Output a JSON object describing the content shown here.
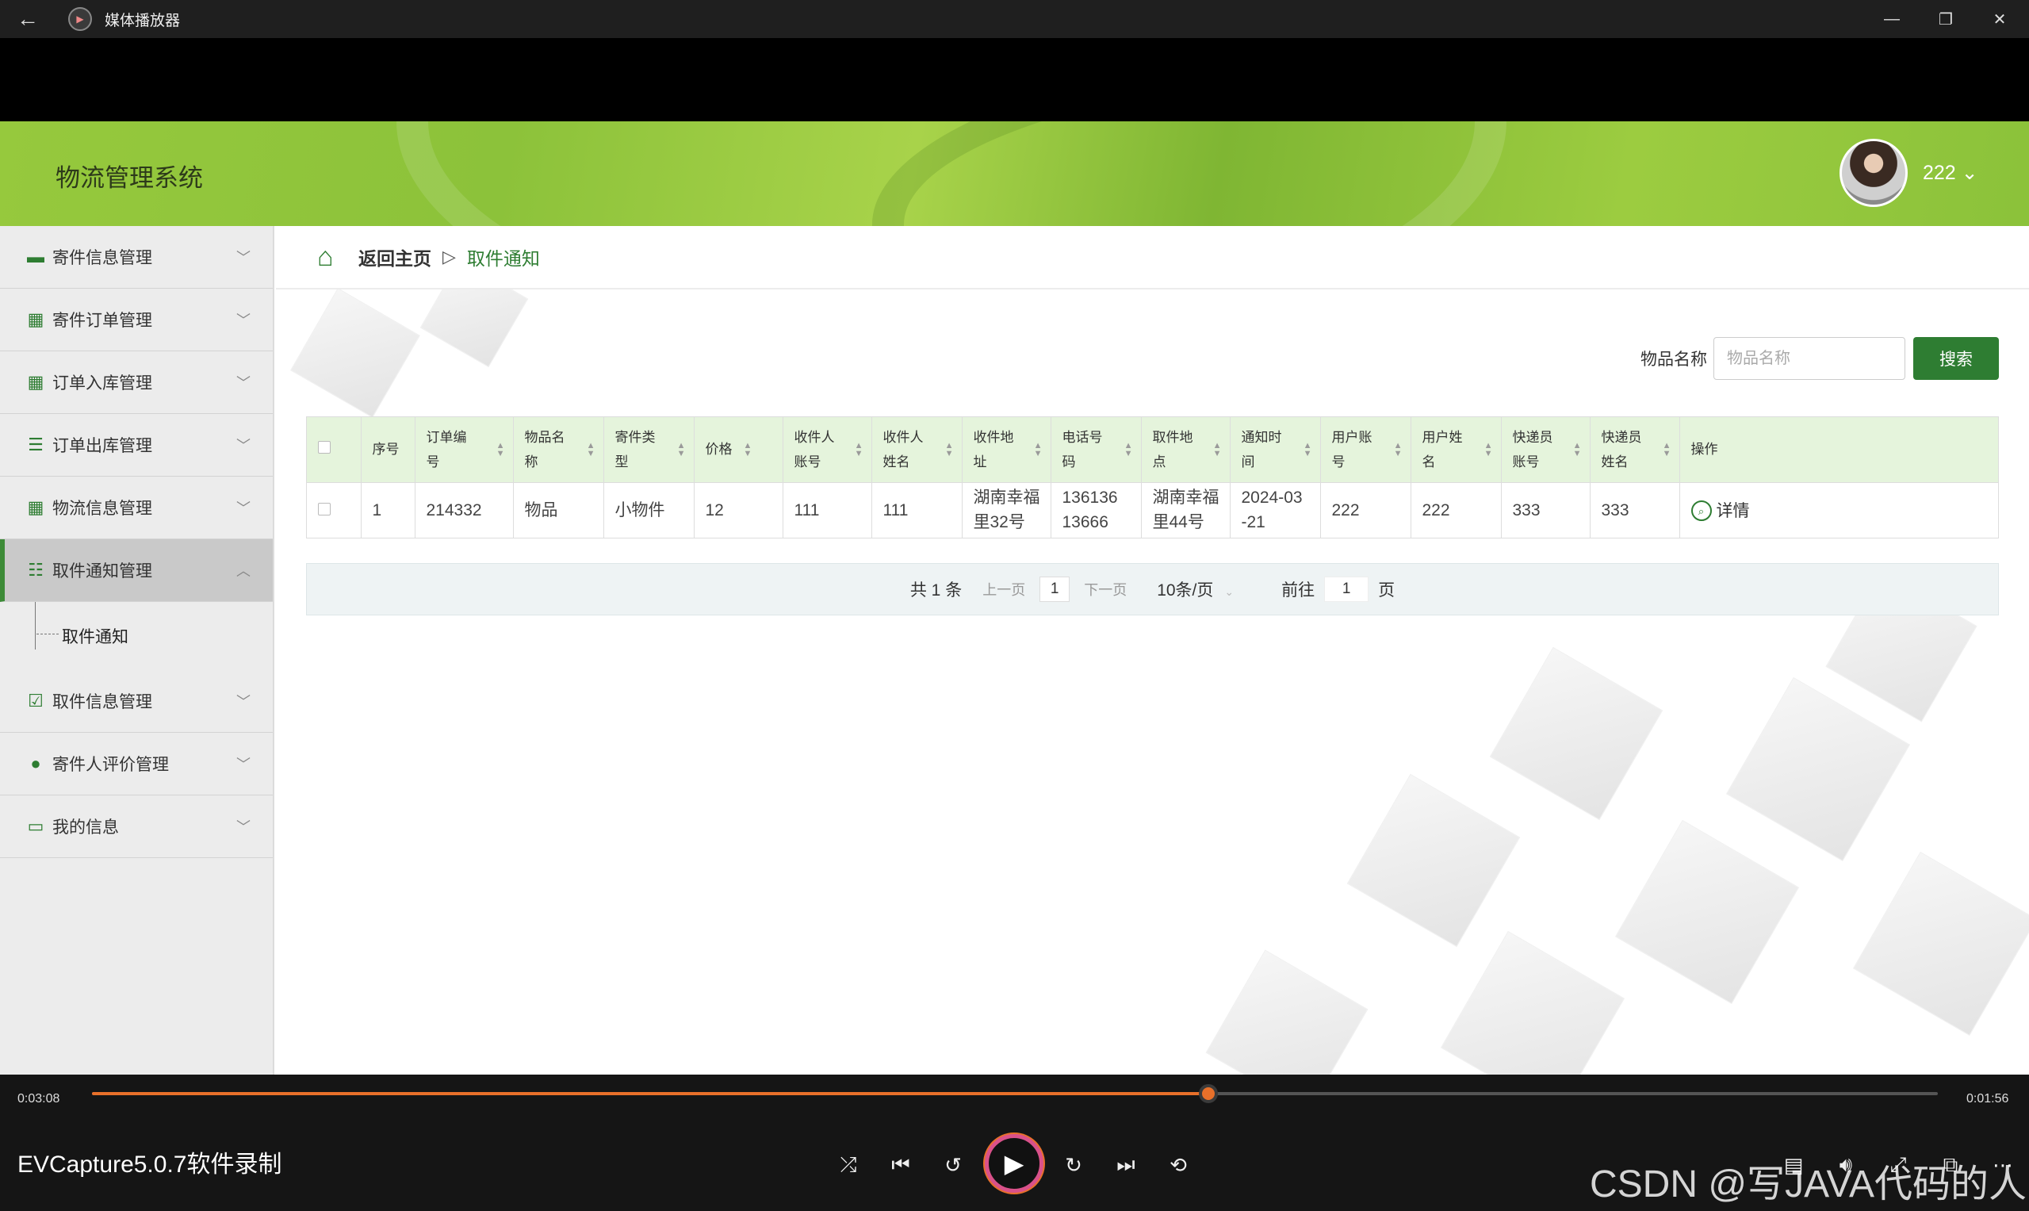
{
  "window": {
    "title": "媒体播放器"
  },
  "app": {
    "system_title": "物流管理系统",
    "user_name": "222 ⌄"
  },
  "sidebar": {
    "items": [
      {
        "label": "寄件信息管理",
        "icon": "briefcase-icon"
      },
      {
        "label": "寄件订单管理",
        "icon": "grid-icon"
      },
      {
        "label": "订单入库管理",
        "icon": "grid-icon"
      },
      {
        "label": "订单出库管理",
        "icon": "list-icon"
      },
      {
        "label": "物流信息管理",
        "icon": "grid-icon"
      },
      {
        "label": "取件通知管理",
        "icon": "sliders-icon",
        "expanded": true
      },
      {
        "label": "取件信息管理",
        "icon": "clipboard-check-icon"
      },
      {
        "label": "寄件人评价管理",
        "icon": "user-icon"
      },
      {
        "label": "我的信息",
        "icon": "card-icon"
      }
    ],
    "submenu": {
      "label": "取件通知"
    }
  },
  "breadcrumb": {
    "home": "返回主页",
    "separator": "▷",
    "current": "取件通知"
  },
  "search": {
    "label": "物品名称",
    "placeholder": "物品名称",
    "button": "搜索"
  },
  "table": {
    "headers": [
      "序号",
      "订单编号",
      "物品名称",
      "寄件类型",
      "价格",
      "收件人账号",
      "收件人姓名",
      "收件地址",
      "电话号码",
      "取件地点",
      "通知时间",
      "用户账号",
      "用户姓名",
      "快递员账号",
      "快递员姓名",
      "操作"
    ],
    "header_lines": [
      [
        "序号"
      ],
      [
        "订单编",
        "号"
      ],
      [
        "物品名",
        "称"
      ],
      [
        "寄件类",
        "型"
      ],
      [
        "价格"
      ],
      [
        "收件人",
        "账号"
      ],
      [
        "收件人",
        "姓名"
      ],
      [
        "收件地",
        "址"
      ],
      [
        "电话号",
        "码"
      ],
      [
        "取件地",
        "点"
      ],
      [
        "通知时",
        "间"
      ],
      [
        "用户账",
        "号"
      ],
      [
        "用户姓",
        "名"
      ],
      [
        "快递员",
        "账号"
      ],
      [
        "快递员",
        "姓名"
      ],
      [
        "操作"
      ]
    ],
    "rows": [
      {
        "index": "1",
        "order_no": "214332",
        "item_name": "物品",
        "ship_type": "小物件",
        "price": "12",
        "recv_account": "111",
        "recv_name": "111",
        "address_l1": "湖南幸福",
        "address_l2": "里32号",
        "phone_l1": "136136",
        "phone_l2": "13666",
        "pickup_l1": "湖南幸福",
        "pickup_l2": "里44号",
        "time_l1": "2024-03",
        "time_l2": "-21",
        "user_account": "222",
        "user_name": "222",
        "courier_account": "333",
        "courier_name": "333",
        "action": "详情"
      }
    ]
  },
  "pager": {
    "total": "共 1 条",
    "prev": "上一页",
    "page": "1",
    "next": "下一页",
    "page_size": "10条/页",
    "goto_label": "前往",
    "goto_value": "1",
    "goto_suffix": "页"
  },
  "player": {
    "elapsed": "0:03:08",
    "remaining": "0:01:56",
    "progress": 0.605,
    "title": "EVCapture5.0.7软件录制",
    "accent": "#e8702a"
  },
  "watermark": "CSDN @写JAVA代码的人",
  "colors": {
    "brand_green": "#2e7d32",
    "header_green": "#8cc23a",
    "table_header": "#e5f4dc"
  }
}
